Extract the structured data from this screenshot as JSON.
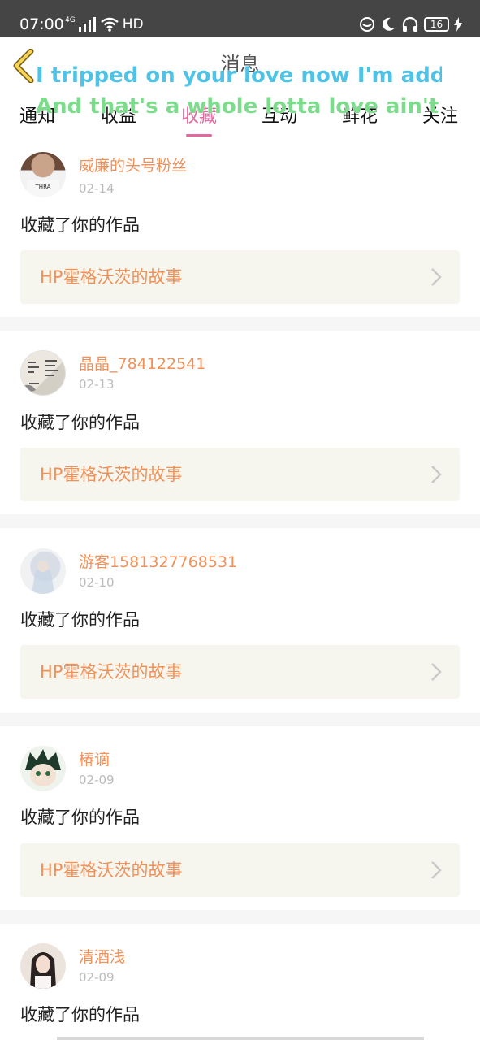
{
  "status_bar": {
    "time": "07:00",
    "network": "4G",
    "hd": "HD",
    "battery": "16"
  },
  "header": {
    "title": "消息"
  },
  "lyrics": {
    "line1": "I tripped on your love now I'm addi",
    "line2": "And that's a whole lotta love ain't"
  },
  "tabs": [
    {
      "label": "通知",
      "active": false
    },
    {
      "label": "收益",
      "active": false
    },
    {
      "label": "收藏",
      "active": true
    },
    {
      "label": "互动",
      "active": false
    },
    {
      "label": "鲜花",
      "active": false
    },
    {
      "label": "关注",
      "active": false
    }
  ],
  "items": [
    {
      "user": "威廉的头号粉丝",
      "date": "02-14",
      "action": "收藏了你的作品",
      "work": "HP霍格沃茨的故事"
    },
    {
      "user": "晶晶_784122541",
      "date": "02-13",
      "action": "收藏了你的作品",
      "work": "HP霍格沃茨的故事"
    },
    {
      "user": "游客1581327768531",
      "date": "02-10",
      "action": "收藏了你的作品",
      "work": "HP霍格沃茨的故事"
    },
    {
      "user": "椿谪",
      "date": "02-09",
      "action": "收藏了你的作品",
      "work": "HP霍格沃茨的故事"
    },
    {
      "user": "清酒浅",
      "date": "02-09",
      "action": "收藏了你的作品"
    }
  ],
  "colors": {
    "accent": "#e468a0",
    "username": "#f0915a",
    "work_bg": "#f6f6ee"
  }
}
